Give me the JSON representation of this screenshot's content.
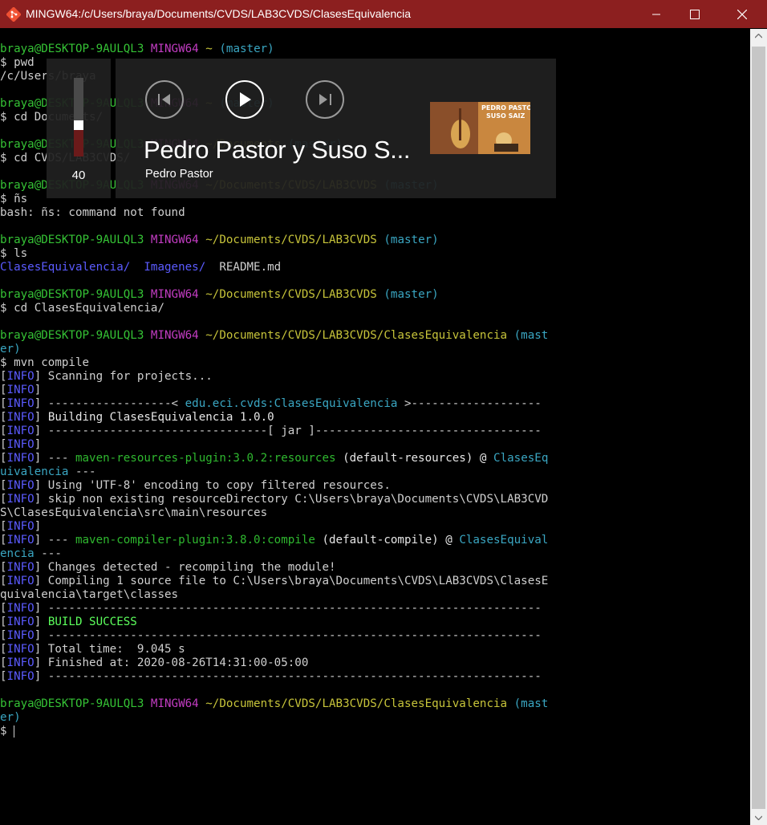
{
  "window": {
    "title": "MINGW64:/c/Users/braya/Documents/CVDS/LAB3CVDS/ClasesEquivalencia",
    "app_icon": "git-bash-icon",
    "title_bar_color": "#8c1f1f"
  },
  "terminal": {
    "lines": [
      [
        {
          "t": "braya@DESKTOP-9AULQL3 ",
          "c": "c-green"
        },
        {
          "t": "MINGW64 ",
          "c": "c-mag"
        },
        {
          "t": "~ ",
          "c": "c-yel"
        },
        {
          "t": "(master)",
          "c": "c-cyan"
        }
      ],
      [
        {
          "t": "$ pwd",
          "c": ""
        }
      ],
      [
        {
          "t": "/c/Users/braya",
          "c": ""
        }
      ],
      [],
      [
        {
          "t": "braya@DESKTOP-9AULQL3 ",
          "c": "c-green"
        },
        {
          "t": "MINGW64 ",
          "c": "c-mag"
        },
        {
          "t": "~ ",
          "c": "c-yel"
        },
        {
          "t": "(master)",
          "c": "c-cyan"
        }
      ],
      [
        {
          "t": "$ cd Documents/",
          "c": ""
        }
      ],
      [],
      [
        {
          "t": "braya@DESKTOP-9AULQL3 ",
          "c": "c-green"
        },
        {
          "t": "MINGW64 ",
          "c": "c-mag"
        },
        {
          "t": "~/Documents ",
          "c": "c-yel"
        },
        {
          "t": "(master)",
          "c": "c-cyan"
        }
      ],
      [
        {
          "t": "$ cd CVDS/LAB3CVDS/",
          "c": ""
        }
      ],
      [],
      [
        {
          "t": "braya@DESKTOP-9AULQL3 ",
          "c": "c-green"
        },
        {
          "t": "MINGW64 ",
          "c": "c-mag"
        },
        {
          "t": "~/Documents/CVDS/LAB3CVDS ",
          "c": "c-yel"
        },
        {
          "t": "(master)",
          "c": "c-cyan"
        }
      ],
      [
        {
          "t": "$ ñs",
          "c": ""
        }
      ],
      [
        {
          "t": "bash: ñs: command not found",
          "c": ""
        }
      ],
      [],
      [
        {
          "t": "braya@DESKTOP-9AULQL3 ",
          "c": "c-green"
        },
        {
          "t": "MINGW64 ",
          "c": "c-mag"
        },
        {
          "t": "~/Documents/CVDS/LAB3CVDS ",
          "c": "c-yel"
        },
        {
          "t": "(master)",
          "c": "c-cyan"
        }
      ],
      [
        {
          "t": "$ ls",
          "c": ""
        }
      ],
      [
        {
          "t": "ClasesEquivalencia/",
          "c": "c-blue"
        },
        {
          "t": "  ",
          "c": ""
        },
        {
          "t": "Imagenes/",
          "c": "c-blue"
        },
        {
          "t": "  README.md",
          "c": ""
        }
      ],
      [],
      [
        {
          "t": "braya@DESKTOP-9AULQL3 ",
          "c": "c-green"
        },
        {
          "t": "MINGW64 ",
          "c": "c-mag"
        },
        {
          "t": "~/Documents/CVDS/LAB3CVDS ",
          "c": "c-yel"
        },
        {
          "t": "(master)",
          "c": "c-cyan"
        }
      ],
      [
        {
          "t": "$ cd ClasesEquivalencia/",
          "c": ""
        }
      ],
      [],
      [
        {
          "t": "braya@DESKTOP-9AULQL3 ",
          "c": "c-green"
        },
        {
          "t": "MINGW64 ",
          "c": "c-mag"
        },
        {
          "t": "~/Documents/CVDS/LAB3CVDS/ClasesEquivalencia ",
          "c": "c-yel"
        },
        {
          "t": "(mast",
          "c": "c-cyan"
        }
      ],
      [
        {
          "t": "er)",
          "c": "c-cyan"
        }
      ],
      [
        {
          "t": "$ mvn compile",
          "c": ""
        }
      ],
      [
        {
          "t": "[",
          "c": ""
        },
        {
          "t": "INFO",
          "c": "c-blue"
        },
        {
          "t": "] Scanning for projects...",
          "c": ""
        }
      ],
      [
        {
          "t": "[",
          "c": ""
        },
        {
          "t": "INFO",
          "c": "c-blue"
        },
        {
          "t": "]",
          "c": ""
        }
      ],
      [
        {
          "t": "[",
          "c": ""
        },
        {
          "t": "INFO",
          "c": "c-blue"
        },
        {
          "t": "] ------------------< ",
          "c": ""
        },
        {
          "t": "edu.eci.cvds:ClasesEquivalencia",
          "c": "c-cyan"
        },
        {
          "t": " >-------------------",
          "c": ""
        }
      ],
      [
        {
          "t": "[",
          "c": ""
        },
        {
          "t": "INFO",
          "c": "c-blue"
        },
        {
          "t": "] ",
          "c": ""
        },
        {
          "t": "Building ClasesEquivalencia 1.0.0",
          "c": "c-white"
        }
      ],
      [
        {
          "t": "[",
          "c": ""
        },
        {
          "t": "INFO",
          "c": "c-blue"
        },
        {
          "t": "] --------------------------------[ jar ]---------------------------------",
          "c": ""
        }
      ],
      [
        {
          "t": "[",
          "c": ""
        },
        {
          "t": "INFO",
          "c": "c-blue"
        },
        {
          "t": "]",
          "c": ""
        }
      ],
      [
        {
          "t": "[",
          "c": ""
        },
        {
          "t": "INFO",
          "c": "c-blue"
        },
        {
          "t": "] --- ",
          "c": ""
        },
        {
          "t": "maven-resources-plugin:3.0.2:resources",
          "c": "c-dgreen"
        },
        {
          "t": " (default-resources) @ ",
          "c": "c-white"
        },
        {
          "t": "ClasesEq",
          "c": "c-cyan"
        }
      ],
      [
        {
          "t": "uivalencia",
          "c": "c-cyan"
        },
        {
          "t": " ---",
          "c": ""
        }
      ],
      [
        {
          "t": "[",
          "c": ""
        },
        {
          "t": "INFO",
          "c": "c-blue"
        },
        {
          "t": "] Using 'UTF-8' encoding to copy filtered resources.",
          "c": ""
        }
      ],
      [
        {
          "t": "[",
          "c": ""
        },
        {
          "t": "INFO",
          "c": "c-blue"
        },
        {
          "t": "] skip non existing resourceDirectory C:\\Users\\braya\\Documents\\CVDS\\LAB3CVD",
          "c": ""
        }
      ],
      [
        {
          "t": "S\\ClasesEquivalencia\\src\\main\\resources",
          "c": ""
        }
      ],
      [
        {
          "t": "[",
          "c": ""
        },
        {
          "t": "INFO",
          "c": "c-blue"
        },
        {
          "t": "]",
          "c": ""
        }
      ],
      [
        {
          "t": "[",
          "c": ""
        },
        {
          "t": "INFO",
          "c": "c-blue"
        },
        {
          "t": "] --- ",
          "c": ""
        },
        {
          "t": "maven-compiler-plugin:3.8.0:compile",
          "c": "c-dgreen"
        },
        {
          "t": " (default-compile) @ ",
          "c": "c-white"
        },
        {
          "t": "ClasesEquival",
          "c": "c-cyan"
        }
      ],
      [
        {
          "t": "encia",
          "c": "c-cyan"
        },
        {
          "t": " ---",
          "c": ""
        }
      ],
      [
        {
          "t": "[",
          "c": ""
        },
        {
          "t": "INFO",
          "c": "c-blue"
        },
        {
          "t": "] Changes detected - recompiling the module!",
          "c": ""
        }
      ],
      [
        {
          "t": "[",
          "c": ""
        },
        {
          "t": "INFO",
          "c": "c-blue"
        },
        {
          "t": "] Compiling 1 source file to C:\\Users\\braya\\Documents\\CVDS\\LAB3CVDS\\ClasesE",
          "c": ""
        }
      ],
      [
        {
          "t": "quivalencia\\target\\classes",
          "c": ""
        }
      ],
      [
        {
          "t": "[",
          "c": ""
        },
        {
          "t": "INFO",
          "c": "c-blue"
        },
        {
          "t": "] ------------------------------------------------------------------------",
          "c": ""
        }
      ],
      [
        {
          "t": "[",
          "c": ""
        },
        {
          "t": "INFO",
          "c": "c-blue"
        },
        {
          "t": "] ",
          "c": ""
        },
        {
          "t": "BUILD SUCCESS",
          "c": "c-bgreen"
        }
      ],
      [
        {
          "t": "[",
          "c": ""
        },
        {
          "t": "INFO",
          "c": "c-blue"
        },
        {
          "t": "] ------------------------------------------------------------------------",
          "c": ""
        }
      ],
      [
        {
          "t": "[",
          "c": ""
        },
        {
          "t": "INFO",
          "c": "c-blue"
        },
        {
          "t": "] Total time:  9.045 s",
          "c": ""
        }
      ],
      [
        {
          "t": "[",
          "c": ""
        },
        {
          "t": "INFO",
          "c": "c-blue"
        },
        {
          "t": "] Finished at: 2020-08-26T14:31:00-05:00",
          "c": ""
        }
      ],
      [
        {
          "t": "[",
          "c": ""
        },
        {
          "t": "INFO",
          "c": "c-blue"
        },
        {
          "t": "] ------------------------------------------------------------------------",
          "c": ""
        }
      ],
      [],
      [
        {
          "t": "braya@DESKTOP-9AULQL3 ",
          "c": "c-green"
        },
        {
          "t": "MINGW64 ",
          "c": "c-mag"
        },
        {
          "t": "~/Documents/CVDS/LAB3CVDS/ClasesEquivalencia ",
          "c": "c-yel"
        },
        {
          "t": "(mast",
          "c": "c-cyan"
        }
      ],
      [
        {
          "t": "er)",
          "c": "c-cyan"
        }
      ],
      [
        {
          "t": "$ ",
          "c": ""
        }
      ]
    ]
  },
  "volume_overlay": {
    "level": 40,
    "level_label": "40"
  },
  "media_overlay": {
    "track_title": "Pedro Pastor y Suso S...",
    "artist": "Pedro Pastor",
    "album_art_text": "PEDRO PASTOR SUSO SAIZ",
    "controls": [
      "previous-track-icon",
      "play-icon",
      "next-track-icon"
    ]
  }
}
